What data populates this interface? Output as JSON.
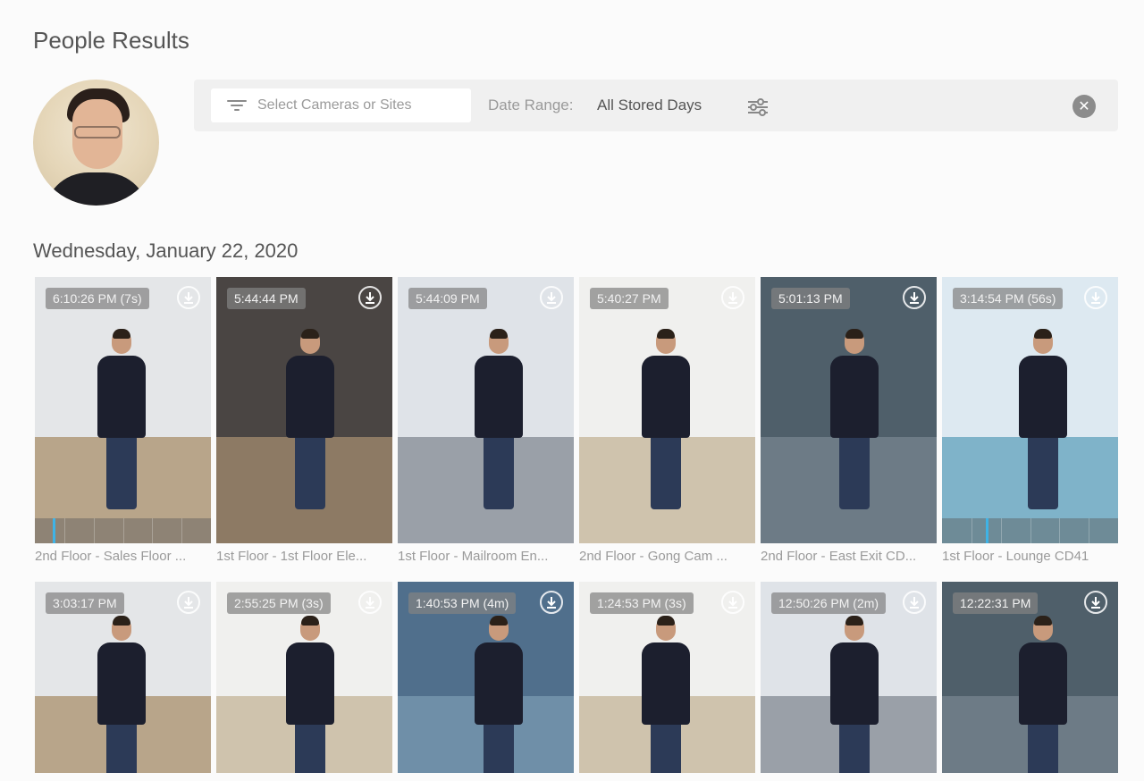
{
  "header": {
    "title": "People Results"
  },
  "filters": {
    "camera_placeholder": "Select Cameras or Sites",
    "date_label": "Date Range:",
    "date_value": "All Stored Days",
    "clear_symbol": "✕"
  },
  "results": {
    "date_heading": "Wednesday, January 22, 2020",
    "row1": [
      {
        "time": "6:10:26 PM (7s)",
        "caption": "2nd Floor - Sales Floor ...",
        "timeline_progress": 0.1,
        "scene": "hall"
      },
      {
        "time": "5:44:44 PM",
        "caption": "1st Floor - 1st Floor Ele...",
        "timeline_progress": null,
        "scene": "dark"
      },
      {
        "time": "5:44:09 PM",
        "caption": "1st Floor - Mailroom En...",
        "timeline_progress": null,
        "scene": "gray"
      },
      {
        "time": "5:40:27 PM",
        "caption": "2nd Floor - Gong Cam ...",
        "timeline_progress": null,
        "scene": "office"
      },
      {
        "time": "5:01:13 PM",
        "caption": "2nd Floor - East Exit CD...",
        "timeline_progress": null,
        "scene": "carpet"
      },
      {
        "time": "3:14:54 PM (56s)",
        "caption": "1st Floor - Lounge CD41",
        "timeline_progress": 0.25,
        "scene": "lounge"
      }
    ],
    "row2": [
      {
        "time": "3:03:17 PM",
        "scene": "hall"
      },
      {
        "time": "2:55:25 PM (3s)",
        "scene": "office"
      },
      {
        "time": "1:40:53 PM (4m)",
        "scene": "blue"
      },
      {
        "time": "1:24:53 PM (3s)",
        "scene": "office"
      },
      {
        "time": "12:50:26 PM (2m)",
        "scene": "gray"
      },
      {
        "time": "12:22:31 PM",
        "scene": "carpet"
      }
    ]
  },
  "icons": {
    "filter": "filter-lines-icon",
    "settings": "sliders-icon",
    "clear": "close-circle-icon",
    "download": "download-icon"
  },
  "colors": {
    "accent": "#3fb3e6",
    "badge_bg": "#828282",
    "caption": "#9a9a9a"
  }
}
